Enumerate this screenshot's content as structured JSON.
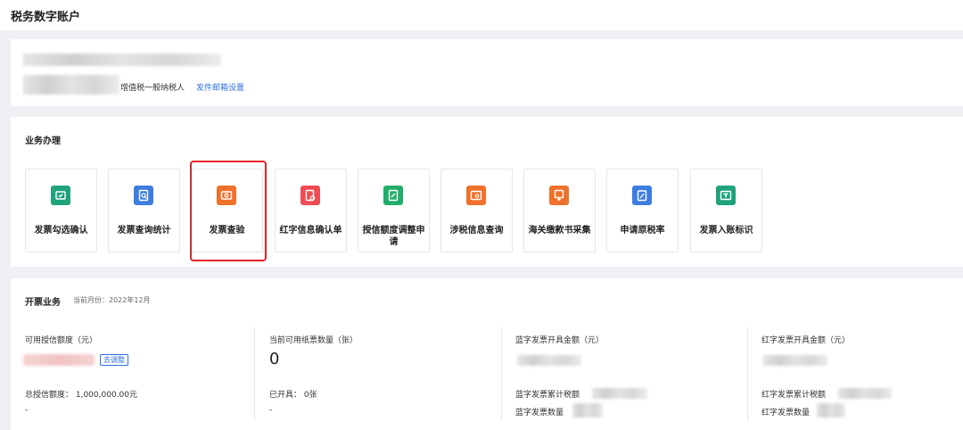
{
  "app_title": "税务数字账户",
  "account": {
    "taxpayer_type": "增值税一般纳税人",
    "email_settings_link": "发件邮箱设置"
  },
  "business": {
    "title": "业务办理",
    "tiles": [
      {
        "label": "发票勾选确认",
        "icon": "check-invoice-icon",
        "color": "#1ea37a"
      },
      {
        "label": "发票查询统计",
        "icon": "search-invoice-icon",
        "color": "#3e7de0"
      },
      {
        "label": "发票查验",
        "icon": "verify-invoice-icon",
        "color": "#f0712b"
      },
      {
        "label": "红字信息确认单",
        "icon": "red-info-icon",
        "color": "#ef4c54"
      },
      {
        "label": "授信额度调整申请",
        "icon": "credit-adjust-icon",
        "color": "#22ae6a"
      },
      {
        "label": "涉税信息查询",
        "icon": "tax-info-icon",
        "color": "#f0712b"
      },
      {
        "label": "海关缴款书采集",
        "icon": "customs-icon",
        "color": "#f0712b"
      },
      {
        "label": "申请原税率",
        "icon": "tax-rate-icon",
        "color": "#3e7de0"
      },
      {
        "label": "发票入账标识",
        "icon": "invoice-entry-icon",
        "color": "#1ea37a"
      }
    ],
    "highlight_color": "#e6242b"
  },
  "invoicing": {
    "title": "开票业务",
    "current_month": "当前月份：2022年12月",
    "available_credit_label": "可用授信额度（元）",
    "adjust_button": "去调整",
    "total_credit": "总授信额度： 1,000,000.00元",
    "total_credit_sub": "-",
    "paper_invoice_label": "当前可用纸票数量（张）",
    "paper_invoice_value": "0",
    "issued": "已开具： 0张",
    "issued_sub": "-",
    "blue_amount_label": "蓝字发票开具金额（元）",
    "blue_total_label": "蓝字发票累计税额",
    "blue_count_label": "蓝字发票数量",
    "red_amount_label": "红字发票开具金额（元）",
    "red_total_label": "红字发票累计税额",
    "red_count_label": "红字发票数量"
  }
}
